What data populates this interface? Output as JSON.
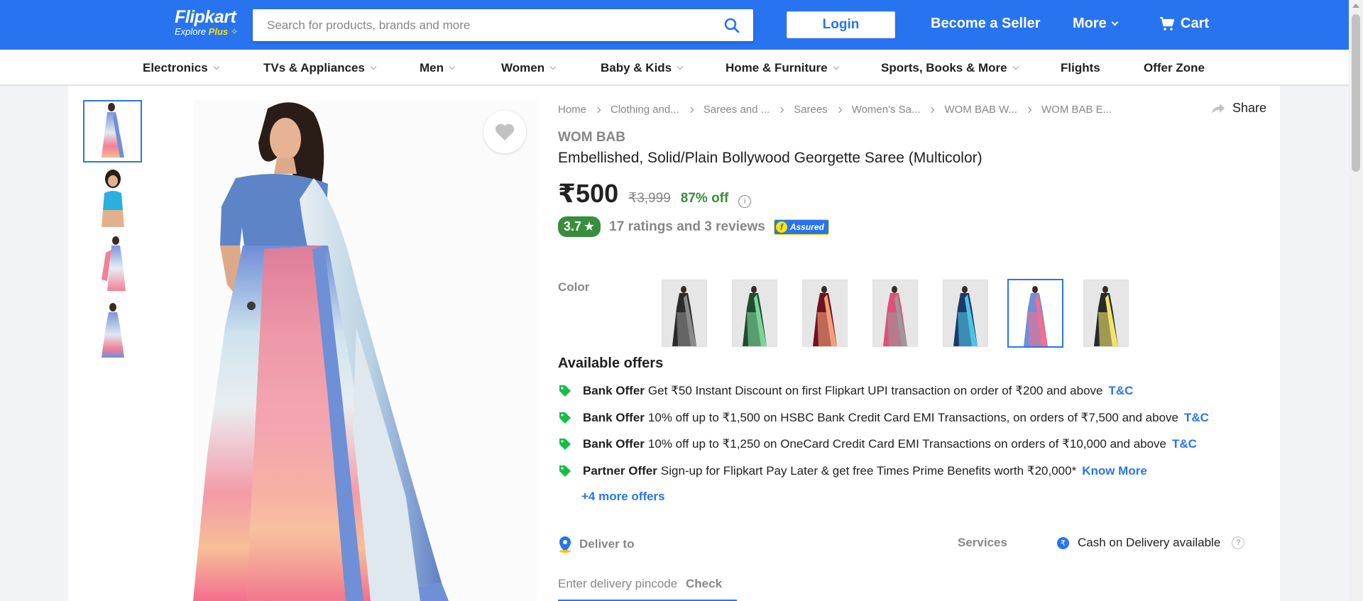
{
  "header": {
    "logo_text": "Flipkart",
    "logo_sub": "Explore",
    "logo_plus": "Plus",
    "search_placeholder": "Search for products, brands and more",
    "login_label": "Login",
    "seller_label": "Become a Seller",
    "more_label": "More",
    "cart_label": "Cart"
  },
  "categories": [
    "Electronics",
    "TVs & Appliances",
    "Men",
    "Women",
    "Baby & Kids",
    "Home & Furniture",
    "Sports, Books & More",
    "Flights",
    "Offer Zone"
  ],
  "breadcrumbs": [
    "Home",
    "Clothing and...",
    "Sarees and ...",
    "Sarees",
    "Women's Sa...",
    "WOM BAB W...",
    "WOM BAB E..."
  ],
  "share_label": "Share",
  "product": {
    "brand": "WOM BAB",
    "title": "Embellished, Solid/Plain Bollywood Georgette Saree  (Multicolor)",
    "price": "₹500",
    "mrp": "₹3,999",
    "discount": "87% off",
    "rating": "3.7",
    "rating_star": "★",
    "ratings_text": "17 ratings and 3 reviews",
    "assured_label": "Assured"
  },
  "color": {
    "label": "Color",
    "swatches": [
      {
        "name": "Black-Grey",
        "colors": [
          "#2b2b2b",
          "#8a8a8a"
        ]
      },
      {
        "name": "Green",
        "colors": [
          "#1f4d2f",
          "#7ed39a"
        ]
      },
      {
        "name": "Maroon-Peach",
        "colors": [
          "#6e1420",
          "#f3a07a"
        ]
      },
      {
        "name": "Pink-Grey",
        "colors": [
          "#e04f7a",
          "#9a9a9a"
        ]
      },
      {
        "name": "Blue-Teal",
        "colors": [
          "#1a3a6e",
          "#4fc3e0"
        ]
      },
      {
        "name": "Multicolor",
        "colors": [
          "#6f8fd6",
          "#f36f8f"
        ]
      },
      {
        "name": "Black-Yellow",
        "colors": [
          "#2a2a2a",
          "#f0e46a"
        ]
      }
    ],
    "selected_index": 5
  },
  "offers": {
    "title": "Available offers",
    "items": [
      {
        "type": "Bank Offer",
        "text": "Get ₹50 Instant Discount on first Flipkart UPI transaction on order of ₹200 and above",
        "link": "T&C"
      },
      {
        "type": "Bank Offer",
        "text": "10% off up to ₹1,500 on HSBC Bank Credit Card EMI Transactions, on orders of ₹7,500 and above",
        "link": "T&C"
      },
      {
        "type": "Bank Offer",
        "text": "10% off up to ₹1,250 on OneCard Credit Card EMI Transactions on orders of ₹10,000 and above",
        "link": "T&C"
      },
      {
        "type": "Partner Offer",
        "text": "Sign-up for Flipkart Pay Later & get free Times Prime Benefits worth ₹20,000*",
        "link": "Know More"
      }
    ],
    "more_label": "+4 more offers"
  },
  "delivery": {
    "deliver_label": "Deliver to",
    "pincode_placeholder": "Enter delivery pincode",
    "check_label": "Check",
    "services_label": "Services",
    "cod_text": "Cash on Delivery available",
    "cod_symbol": "₹",
    "help_symbol": "?"
  },
  "colors": {
    "brand_blue": "#2874f0",
    "price_green": "#388e3c",
    "muted": "#878787"
  }
}
